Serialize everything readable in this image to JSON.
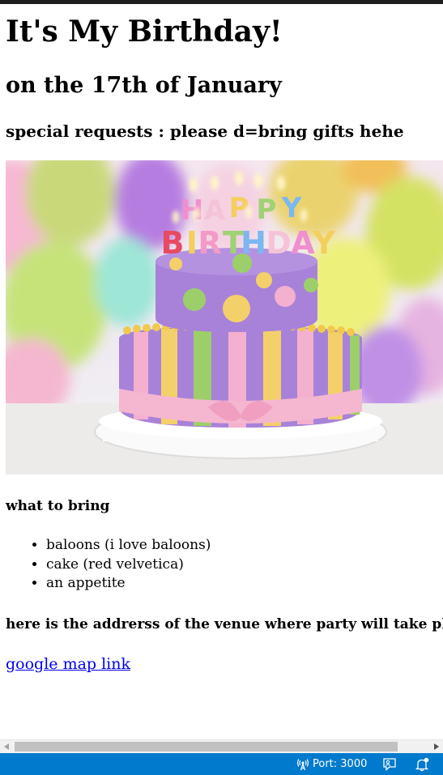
{
  "page": {
    "title": "It's My Birthday!",
    "date_heading": "on the 17th of January",
    "requests_heading": "special requests : please d=bring gifts hehe",
    "bring_heading": "what to bring",
    "bring_items": [
      "baloons (i love baloons)",
      "cake (red velvetica)",
      "an appetite"
    ],
    "address_heading": "here is the addrerss of the venue where party will take place",
    "map_link": "google map link"
  },
  "image": {
    "subject": "birthday cake with happy birthday candles and balloons",
    "candle_text": "HAPPY BIRTHDAY"
  },
  "status_bar": {
    "port_label": "Port: 3000",
    "port_icon": "broadcast-icon",
    "feedback_icon": "feedback-icon",
    "bell_icon": "bell-icon",
    "background": "#007acc"
  },
  "colors": {
    "link": "#0000ee",
    "scroll_thumb": "#c1c1c1"
  }
}
